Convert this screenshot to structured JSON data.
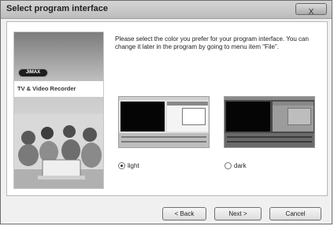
{
  "window": {
    "title": "Select program interface",
    "close_label": "X"
  },
  "sidepanel": {
    "logo_text": "JIMAX",
    "product_label": "TV & Video Recorder"
  },
  "main": {
    "message": "Please select the color you prefer for your program interface. You can change it later in the program by going to menu item \"File\"."
  },
  "options": [
    {
      "label": "light",
      "selected": true
    },
    {
      "label": "dark",
      "selected": false
    }
  ],
  "buttons": {
    "back": "< Back",
    "next": "Next >",
    "cancel": "Cancel"
  }
}
